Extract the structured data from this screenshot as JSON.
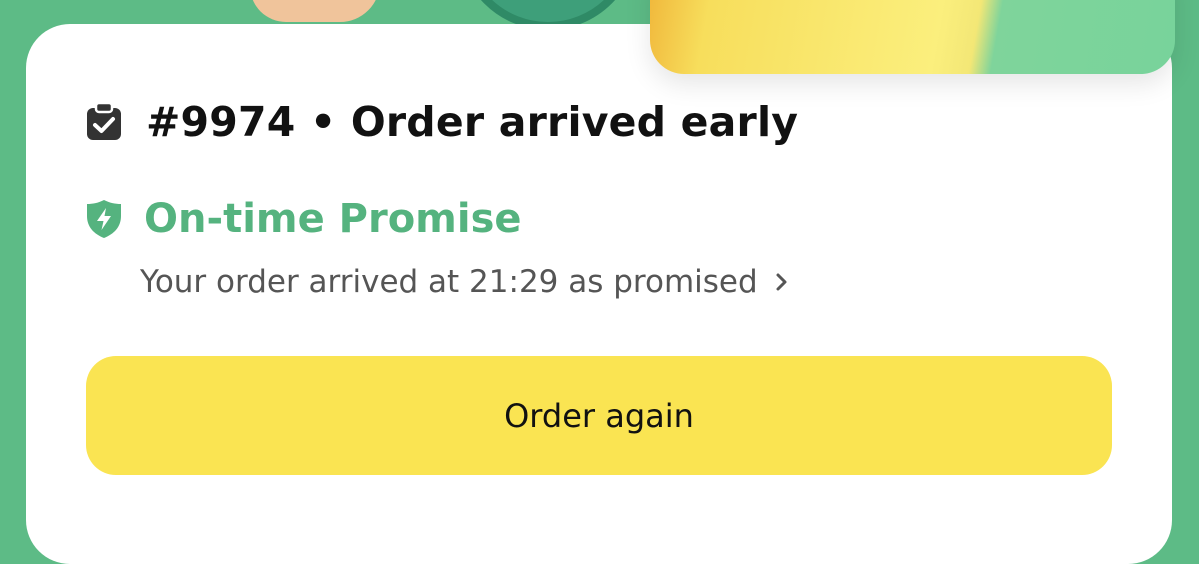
{
  "order": {
    "title": "#9974 • Order arrived early",
    "icon": "clipboard-check-icon"
  },
  "promise": {
    "title": "On-time Promise",
    "subtitle": "Your order arrived at 21:29 as promised",
    "icon": "shield-bolt-icon",
    "chevron": "chevron-right-icon",
    "accent_color": "#55b37f"
  },
  "actions": {
    "order_again_label": "Order again",
    "button_color": "#fae452"
  },
  "theme": {
    "background_color": "#5dbb86",
    "card_color": "#ffffff"
  }
}
